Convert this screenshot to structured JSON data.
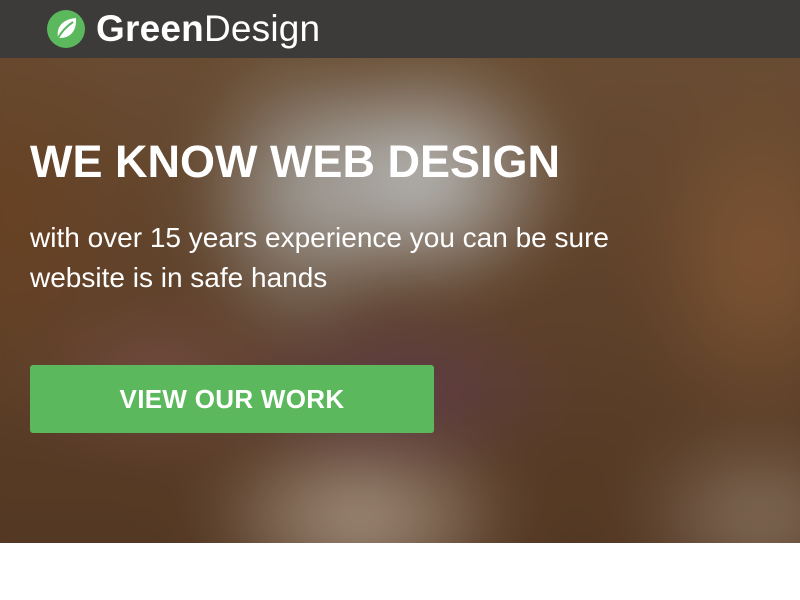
{
  "header": {
    "brand_bold": "Green",
    "brand_light": "Design",
    "logo_icon": "leaf-icon",
    "colors": {
      "bar": "#3c3b39",
      "logo_circle": "#5cb85c",
      "leaf": "#ffffff"
    }
  },
  "hero": {
    "title": "WE KNOW WEB DESIGN",
    "subtitle": "with over 15 years experience you can be sure website is in safe hands",
    "cta_label": "VIEW OUR WORK",
    "colors": {
      "cta_background": "#5cb85c",
      "text": "#ffffff"
    }
  }
}
